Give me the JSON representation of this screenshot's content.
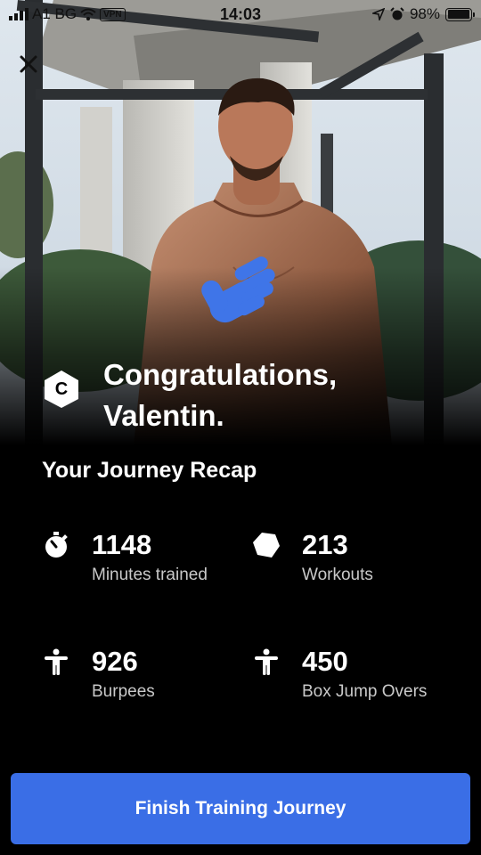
{
  "status_bar": {
    "carrier": "A1 BG",
    "vpn": "VPN",
    "time": "14:03",
    "battery": "98%",
    "battery_level": 0.98
  },
  "hero": {
    "close_icon": "close-icon",
    "hand_icon": "hand-icon"
  },
  "header": {
    "logo_letter": "C",
    "title": "Congratulations, Valentin."
  },
  "recap": {
    "title": "Your Journey Recap",
    "stats": [
      {
        "icon": "stopwatch-icon",
        "value": "1148",
        "label": "Minutes trained"
      },
      {
        "icon": "pentagon-icon",
        "value": "213",
        "label": "Workouts"
      },
      {
        "icon": "person-icon",
        "value": "926",
        "label": "Burpees"
      },
      {
        "icon": "person-icon",
        "value": "450",
        "label": "Box Jump Overs"
      }
    ]
  },
  "cta": {
    "label": "Finish Training Journey"
  },
  "colors": {
    "accent": "#3a6ee6",
    "hand": "#3f75e8",
    "background": "#000000"
  }
}
